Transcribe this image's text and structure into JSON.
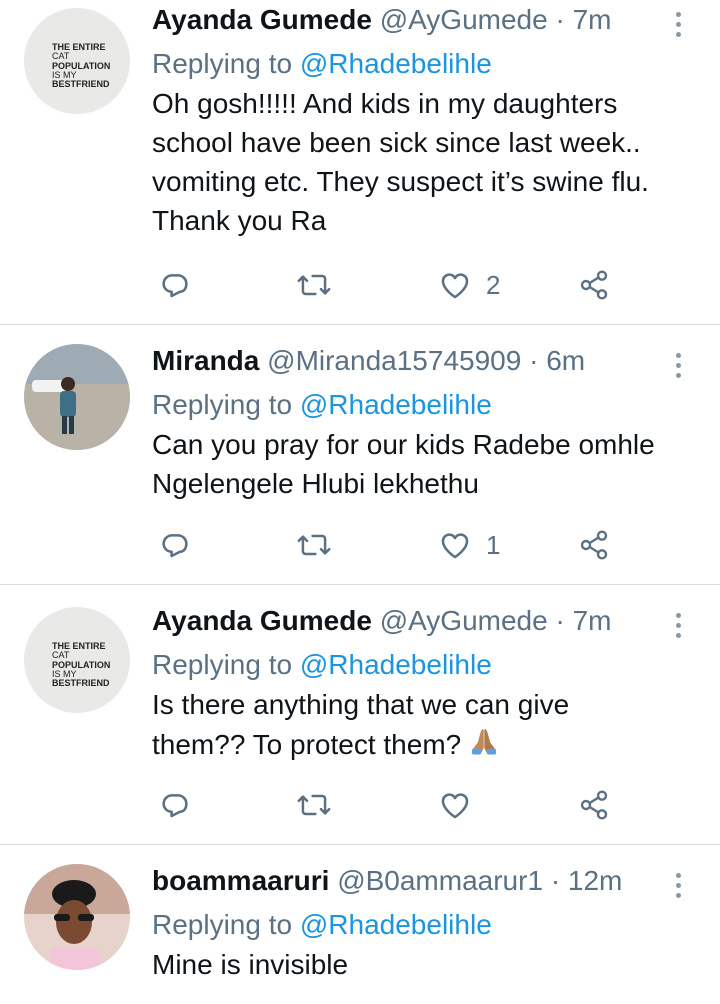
{
  "tweets": [
    {
      "name": "Ayanda Gumede",
      "handle": "@AyGumede",
      "time": "· 7m",
      "replying_prefix": "Replying to",
      "replying_to": "@Rhadebelihle",
      "lines": [
        "Oh gosh!!!!! And kids in my daughters",
        "school have been sick since last week..",
        "vomiting etc. They suspect it’s swine flu.",
        "Thank you Ra"
      ],
      "like_count": "2",
      "avatar": {
        "shirt_text": [
          "THE ENTIRE",
          "CAT",
          "POPULATION",
          "IS MY",
          "BESTFRIEND"
        ]
      }
    },
    {
      "name": "Miranda",
      "handle": "@Miranda15745909",
      "time": "· 6m",
      "replying_prefix": "Replying to",
      "replying_to": "@Rhadebelihle",
      "lines": [
        "Can you pray for our kids Radebe omhle",
        "Ngelengele Hlubi lekhethu"
      ],
      "like_count": "1"
    },
    {
      "name": "Ayanda Gumede",
      "handle": "@AyGumede",
      "time": "· 7m",
      "replying_prefix": "Replying to",
      "replying_to": "@Rhadebelihle",
      "lines": [
        "Is there anything that we can give",
        "them?? To protect them?"
      ],
      "like_count": "",
      "emoji": "folded-hands",
      "avatar": {
        "shirt_text": [
          "THE ENTIRE",
          "CAT",
          "POPULATION",
          "IS MY",
          "BESTFRIEND"
        ]
      }
    },
    {
      "name": "boammaaruri",
      "handle": "@B0ammaarur1",
      "time": "· 12m",
      "replying_prefix": "Replying to",
      "replying_to": "@Rhadebelihle",
      "lines": [
        "Mine is invisible"
      ]
    }
  ],
  "icons": [
    "reply-icon",
    "retweet-icon",
    "like-icon",
    "share-icon",
    "more-options-icon"
  ],
  "colors": {
    "link": "#1b95e0",
    "secondary": "#5b7083",
    "text": "#0f1419",
    "separator": "#d8dde1"
  }
}
